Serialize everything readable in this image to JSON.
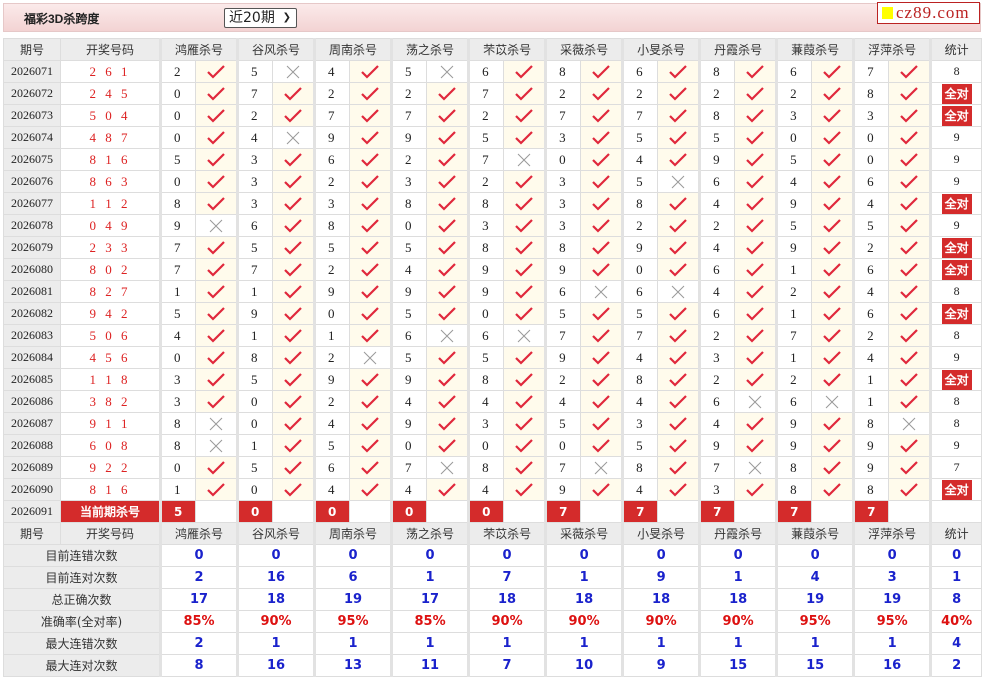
{
  "header": {
    "title": "福彩3D杀跨度",
    "period_select": "近20期",
    "logo": "cz89.com"
  },
  "columns": {
    "issue": "期号",
    "draw": "开奖号码",
    "experts": [
      "鸿雁杀号",
      "谷风杀号",
      "周南杀号",
      "荡之杀号",
      "芣苡杀号",
      "采薇杀号",
      "小旻杀号",
      "丹霞杀号",
      "蒹葭杀号",
      "浮萍杀号"
    ],
    "stat": "统计"
  },
  "rows": [
    {
      "issue": "2026071",
      "draw": "2 6 1",
      "kills": [
        "2",
        "5",
        "4",
        "5",
        "6",
        "8",
        "6",
        "8",
        "6",
        "7"
      ],
      "hits": [
        1,
        0,
        1,
        0,
        1,
        1,
        1,
        1,
        1,
        1
      ],
      "stat": "8"
    },
    {
      "issue": "2026072",
      "draw": "2 4 5",
      "kills": [
        "0",
        "7",
        "2",
        "2",
        "7",
        "2",
        "2",
        "2",
        "2",
        "8"
      ],
      "hits": [
        1,
        1,
        1,
        1,
        1,
        1,
        1,
        1,
        1,
        1
      ],
      "stat": "全对"
    },
    {
      "issue": "2026073",
      "draw": "5 0 4",
      "kills": [
        "0",
        "2",
        "7",
        "7",
        "2",
        "7",
        "7",
        "8",
        "3",
        "3"
      ],
      "hits": [
        1,
        1,
        1,
        1,
        1,
        1,
        1,
        1,
        1,
        1
      ],
      "stat": "全对"
    },
    {
      "issue": "2026074",
      "draw": "4 8 7",
      "kills": [
        "0",
        "4",
        "9",
        "9",
        "5",
        "3",
        "5",
        "5",
        "0",
        "0"
      ],
      "hits": [
        1,
        0,
        1,
        1,
        1,
        1,
        1,
        1,
        1,
        1
      ],
      "stat": "9"
    },
    {
      "issue": "2026075",
      "draw": "8 1 6",
      "kills": [
        "5",
        "3",
        "6",
        "2",
        "7",
        "0",
        "4",
        "9",
        "5",
        "0"
      ],
      "hits": [
        1,
        1,
        1,
        1,
        0,
        1,
        1,
        1,
        1,
        1
      ],
      "stat": "9"
    },
    {
      "issue": "2026076",
      "draw": "8 6 3",
      "kills": [
        "0",
        "3",
        "2",
        "3",
        "2",
        "3",
        "5",
        "6",
        "4",
        "6"
      ],
      "hits": [
        1,
        1,
        1,
        1,
        1,
        1,
        0,
        1,
        1,
        1
      ],
      "stat": "9"
    },
    {
      "issue": "2026077",
      "draw": "1 1 2",
      "kills": [
        "8",
        "3",
        "3",
        "8",
        "8",
        "3",
        "8",
        "4",
        "9",
        "4"
      ],
      "hits": [
        1,
        1,
        1,
        1,
        1,
        1,
        1,
        1,
        1,
        1
      ],
      "stat": "全对"
    },
    {
      "issue": "2026078",
      "draw": "0 4 9",
      "kills": [
        "9",
        "6",
        "8",
        "0",
        "3",
        "3",
        "2",
        "2",
        "5",
        "5"
      ],
      "hits": [
        0,
        1,
        1,
        1,
        1,
        1,
        1,
        1,
        1,
        1
      ],
      "stat": "9"
    },
    {
      "issue": "2026079",
      "draw": "2 3 3",
      "kills": [
        "7",
        "5",
        "5",
        "5",
        "8",
        "8",
        "9",
        "4",
        "9",
        "2"
      ],
      "hits": [
        1,
        1,
        1,
        1,
        1,
        1,
        1,
        1,
        1,
        1
      ],
      "stat": "全对"
    },
    {
      "issue": "2026080",
      "draw": "8 0 2",
      "kills": [
        "7",
        "7",
        "2",
        "4",
        "9",
        "9",
        "0",
        "6",
        "1",
        "6"
      ],
      "hits": [
        1,
        1,
        1,
        1,
        1,
        1,
        1,
        1,
        1,
        1
      ],
      "stat": "全对"
    },
    {
      "issue": "2026081",
      "draw": "8 2 7",
      "kills": [
        "1",
        "1",
        "9",
        "9",
        "9",
        "6",
        "6",
        "4",
        "2",
        "4"
      ],
      "hits": [
        1,
        1,
        1,
        1,
        1,
        0,
        0,
        1,
        1,
        1
      ],
      "stat": "8"
    },
    {
      "issue": "2026082",
      "draw": "9 4 2",
      "kills": [
        "5",
        "9",
        "0",
        "5",
        "0",
        "5",
        "5",
        "6",
        "1",
        "6"
      ],
      "hits": [
        1,
        1,
        1,
        1,
        1,
        1,
        1,
        1,
        1,
        1
      ],
      "stat": "全对"
    },
    {
      "issue": "2026083",
      "draw": "5 0 6",
      "kills": [
        "4",
        "1",
        "1",
        "6",
        "6",
        "7",
        "7",
        "2",
        "7",
        "2"
      ],
      "hits": [
        1,
        1,
        1,
        0,
        0,
        1,
        1,
        1,
        1,
        1
      ],
      "stat": "8"
    },
    {
      "issue": "2026084",
      "draw": "4 5 6",
      "kills": [
        "0",
        "8",
        "2",
        "5",
        "5",
        "9",
        "4",
        "3",
        "1",
        "4"
      ],
      "hits": [
        1,
        1,
        0,
        1,
        1,
        1,
        1,
        1,
        1,
        1
      ],
      "stat": "9"
    },
    {
      "issue": "2026085",
      "draw": "1 1 8",
      "kills": [
        "3",
        "5",
        "9",
        "9",
        "8",
        "2",
        "8",
        "2",
        "2",
        "1"
      ],
      "hits": [
        1,
        1,
        1,
        1,
        1,
        1,
        1,
        1,
        1,
        1
      ],
      "stat": "全对"
    },
    {
      "issue": "2026086",
      "draw": "3 8 2",
      "kills": [
        "3",
        "0",
        "2",
        "4",
        "4",
        "4",
        "4",
        "6",
        "6",
        "1"
      ],
      "hits": [
        1,
        1,
        1,
        1,
        1,
        1,
        1,
        0,
        0,
        1
      ],
      "stat": "8"
    },
    {
      "issue": "2026087",
      "draw": "9 1 1",
      "kills": [
        "8",
        "0",
        "4",
        "9",
        "3",
        "5",
        "3",
        "4",
        "9",
        "8"
      ],
      "hits": [
        0,
        1,
        1,
        1,
        1,
        1,
        1,
        1,
        1,
        0
      ],
      "stat": "8"
    },
    {
      "issue": "2026088",
      "draw": "6 0 8",
      "kills": [
        "8",
        "1",
        "5",
        "0",
        "0",
        "0",
        "5",
        "9",
        "9",
        "9"
      ],
      "hits": [
        0,
        1,
        1,
        1,
        1,
        1,
        1,
        1,
        1,
        1
      ],
      "stat": "9"
    },
    {
      "issue": "2026089",
      "draw": "9 2 2",
      "kills": [
        "0",
        "5",
        "6",
        "7",
        "8",
        "7",
        "8",
        "7",
        "8",
        "9"
      ],
      "hits": [
        1,
        1,
        1,
        0,
        1,
        0,
        1,
        0,
        1,
        1
      ],
      "stat": "7"
    },
    {
      "issue": "2026090",
      "draw": "8 1 6",
      "kills": [
        "1",
        "0",
        "4",
        "4",
        "4",
        "9",
        "4",
        "3",
        "8",
        "8"
      ],
      "hits": [
        1,
        1,
        1,
        1,
        1,
        1,
        1,
        1,
        1,
        1
      ],
      "stat": "全对"
    }
  ],
  "current": {
    "issue": "2026091",
    "label": "当前期杀号",
    "kills": [
      "5",
      "0",
      "0",
      "0",
      "0",
      "7",
      "7",
      "7",
      "7",
      "7"
    ]
  },
  "stats": [
    {
      "label": "目前连错次数",
      "values": [
        "0",
        "0",
        "0",
        "0",
        "0",
        "0",
        "0",
        "0",
        "0",
        "0",
        "0"
      ]
    },
    {
      "label": "目前连对次数",
      "values": [
        "2",
        "16",
        "6",
        "1",
        "7",
        "1",
        "9",
        "1",
        "4",
        "3",
        "1"
      ]
    },
    {
      "label": "总正确次数",
      "values": [
        "17",
        "18",
        "19",
        "17",
        "18",
        "18",
        "18",
        "18",
        "19",
        "19",
        "8"
      ]
    },
    {
      "label": "准确率(全对率)",
      "values": [
        "85%",
        "90%",
        "95%",
        "85%",
        "90%",
        "90%",
        "90%",
        "90%",
        "95%",
        "95%",
        "40%"
      ],
      "highlight": true
    },
    {
      "label": "最大连错次数",
      "values": [
        "2",
        "1",
        "1",
        "1",
        "1",
        "1",
        "1",
        "1",
        "1",
        "1",
        "4"
      ]
    },
    {
      "label": "最大连对次数",
      "values": [
        "8",
        "16",
        "13",
        "11",
        "7",
        "10",
        "9",
        "15",
        "15",
        "16",
        "2"
      ]
    }
  ],
  "colors": {
    "accent": "#d42b2b",
    "check": "#e0283c",
    "cross": "#999999",
    "stat_blue": "#1a22cc"
  }
}
